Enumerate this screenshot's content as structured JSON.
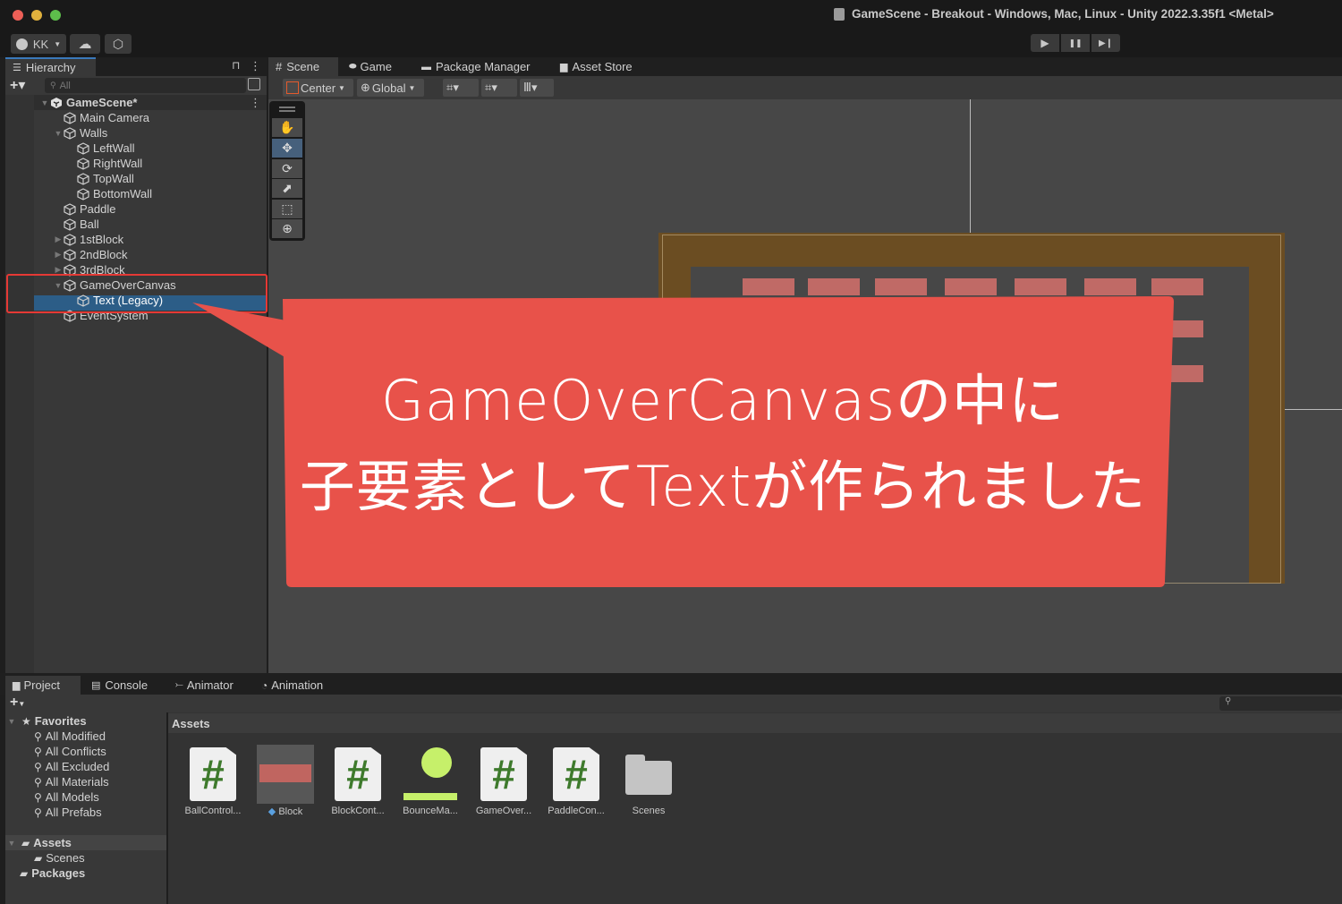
{
  "window": {
    "title": "GameScene - Breakout - Windows, Mac, Linux - Unity 2022.3.35f1 <Metal>",
    "traffic_lights": {
      "close": "#ec5f57",
      "minimize": "#e0b13d",
      "maximize": "#5dbe4b"
    }
  },
  "toolbar": {
    "account_label": "KK",
    "account_icon": "user-circle-icon",
    "cloud_icon": "cloud-icon",
    "services_icon": "hexagon-settings-icon",
    "play_icon": "▶",
    "pause_icon": "❚❚",
    "step_icon": "▶❙"
  },
  "hierarchy": {
    "tab_label": "Hierarchy",
    "search_placeholder": "All",
    "add_label": "+▾",
    "items": [
      {
        "label": "GameScene*",
        "depth": 0,
        "expanded": true,
        "bold": true,
        "type": "scene"
      },
      {
        "label": "Main Camera",
        "depth": 1,
        "type": "gameobject"
      },
      {
        "label": "Walls",
        "depth": 1,
        "expanded": true,
        "type": "gameobject"
      },
      {
        "label": "LeftWall",
        "depth": 2,
        "type": "gameobject"
      },
      {
        "label": "RightWall",
        "depth": 2,
        "type": "gameobject"
      },
      {
        "label": "TopWall",
        "depth": 2,
        "type": "gameobject"
      },
      {
        "label": "BottomWall",
        "depth": 2,
        "type": "gameobject"
      },
      {
        "label": "Paddle",
        "depth": 1,
        "type": "gameobject"
      },
      {
        "label": "Ball",
        "depth": 1,
        "type": "gameobject"
      },
      {
        "label": "1stBlock",
        "depth": 1,
        "collapsed": true,
        "type": "gameobject"
      },
      {
        "label": "2ndBlock",
        "depth": 1,
        "collapsed": true,
        "type": "gameobject"
      },
      {
        "label": "3rdBlock",
        "depth": 1,
        "collapsed": true,
        "type": "gameobject"
      },
      {
        "label": "GameOverCanvas",
        "depth": 1,
        "expanded": true,
        "type": "gameobject"
      },
      {
        "label": "Text (Legacy)",
        "depth": 2,
        "selected": true,
        "type": "gameobject"
      },
      {
        "label": "EventSystem",
        "depth": 1,
        "type": "gameobject"
      }
    ]
  },
  "scene": {
    "tabs": [
      {
        "label": "Scene",
        "icon": "#",
        "active": true
      },
      {
        "label": "Game",
        "icon": "gamepad"
      },
      {
        "label": "Package Manager",
        "icon": "box"
      },
      {
        "label": "Asset Store",
        "icon": "bag"
      }
    ],
    "pivot_label": "Center",
    "space_label": "Global",
    "tools": [
      "hand",
      "move",
      "rotate",
      "scale",
      "rect",
      "transform"
    ],
    "active_tool": "move"
  },
  "callout": {
    "line1": "GameOverCanvasの中に",
    "line2": "子要素としてTextが作られました",
    "color": "#e8524a"
  },
  "project": {
    "tabs": [
      {
        "label": "Project",
        "active": true
      },
      {
        "label": "Console"
      },
      {
        "label": "Animator"
      },
      {
        "label": "Animation"
      }
    ],
    "favorites_label": "Favorites",
    "favorites": [
      "All Modified",
      "All Conflicts",
      "All Excluded",
      "All Materials",
      "All Models",
      "All Prefabs"
    ],
    "tree": [
      {
        "label": "Assets",
        "expanded": true
      },
      {
        "label": "Scenes",
        "child": true
      },
      {
        "label": "Packages"
      }
    ],
    "breadcrumb": "Assets",
    "assets": [
      {
        "label": "BallControl...",
        "type": "script"
      },
      {
        "label": "Block",
        "type": "prefab"
      },
      {
        "label": "BlockCont...",
        "type": "script"
      },
      {
        "label": "BounceMa...",
        "type": "physics-material"
      },
      {
        "label": "GameOver...",
        "type": "script"
      },
      {
        "label": "PaddleCon...",
        "type": "script"
      },
      {
        "label": "Scenes",
        "type": "folder"
      }
    ]
  }
}
